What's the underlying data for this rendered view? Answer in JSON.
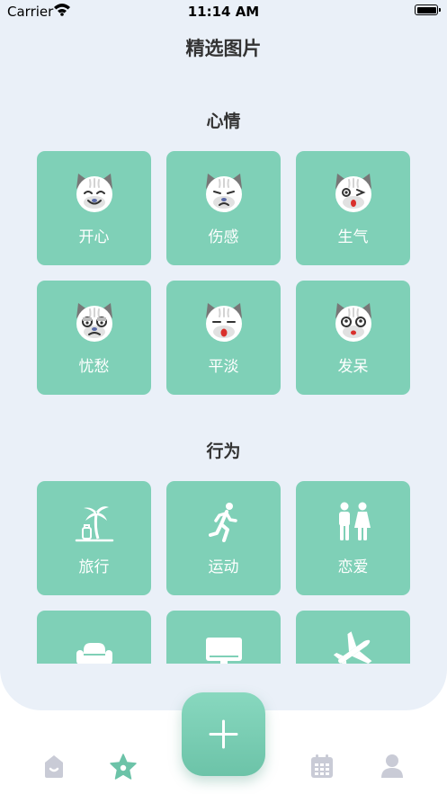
{
  "status_bar": {
    "carrier": "Carrier",
    "time": "11:14 AM"
  },
  "page": {
    "title": "精选图片"
  },
  "sections": [
    {
      "title": "心情",
      "items": [
        {
          "label": "开心",
          "icon": "happy-cat-icon"
        },
        {
          "label": "伤感",
          "icon": "sad-cat-icon"
        },
        {
          "label": "生气",
          "icon": "angry-cat-icon"
        },
        {
          "label": "忧愁",
          "icon": "worried-cat-icon"
        },
        {
          "label": "平淡",
          "icon": "calm-cat-icon"
        },
        {
          "label": "发呆",
          "icon": "daze-cat-icon"
        }
      ]
    },
    {
      "title": "行为",
      "items": [
        {
          "label": "旅行",
          "icon": "palm-tree-icon"
        },
        {
          "label": "运动",
          "icon": "running-icon"
        },
        {
          "label": "恋爱",
          "icon": "couple-icon"
        },
        {
          "label": "",
          "icon": "sofa-icon"
        },
        {
          "label": "",
          "icon": "monitor-icon"
        },
        {
          "label": "",
          "icon": "airplane-icon"
        }
      ]
    }
  ],
  "tab_bar": {
    "tabs": [
      {
        "name": "home",
        "icon": "home-icon",
        "active": false
      },
      {
        "name": "featured",
        "icon": "star-icon",
        "active": true
      },
      {
        "name": "calendar",
        "icon": "calendar-icon",
        "active": false
      },
      {
        "name": "profile",
        "icon": "person-icon",
        "active": false
      }
    ],
    "fab": {
      "icon": "plus-icon"
    }
  },
  "colors": {
    "background": "#eaf0f8",
    "tile": "#7fd0b7",
    "accent": "#6cc3a8",
    "tab_inactive": "#c9cbd6"
  }
}
